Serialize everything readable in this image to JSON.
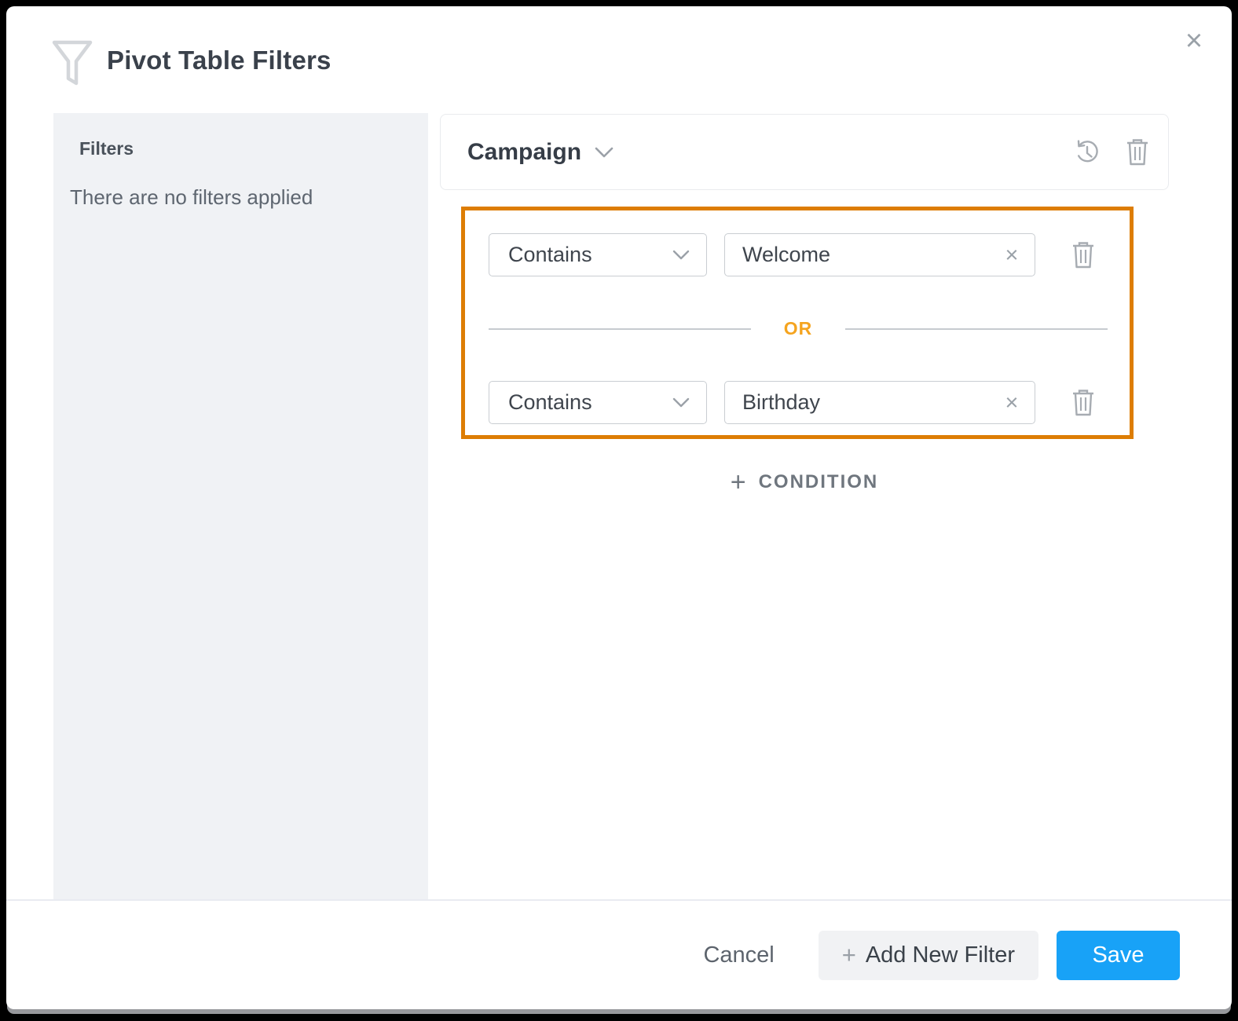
{
  "dialog": {
    "title": "Pivot Table Filters",
    "close_label": "×"
  },
  "sidebar": {
    "title": "Filters",
    "empty_message": "There are no filters applied"
  },
  "filter_editor": {
    "field": {
      "label": "Campaign"
    },
    "conjunction": "OR",
    "conditions": [
      {
        "operator": "Contains",
        "value": "Welcome",
        "clear_label": "×"
      },
      {
        "operator": "Contains",
        "value": "Birthday",
        "clear_label": "×"
      }
    ],
    "add_condition": {
      "plus": "+",
      "label": "CONDITION"
    }
  },
  "footer": {
    "cancel_label": "Cancel",
    "add_new_filter_plus": "+",
    "add_new_filter_label": "Add New Filter",
    "save_label": "Save"
  },
  "colors": {
    "highlight_orange": "#dd7d04",
    "conjunction_orange": "#f5a41f",
    "save_blue": "#18a2f7",
    "sidebar_gray": "#f0f2f5"
  }
}
